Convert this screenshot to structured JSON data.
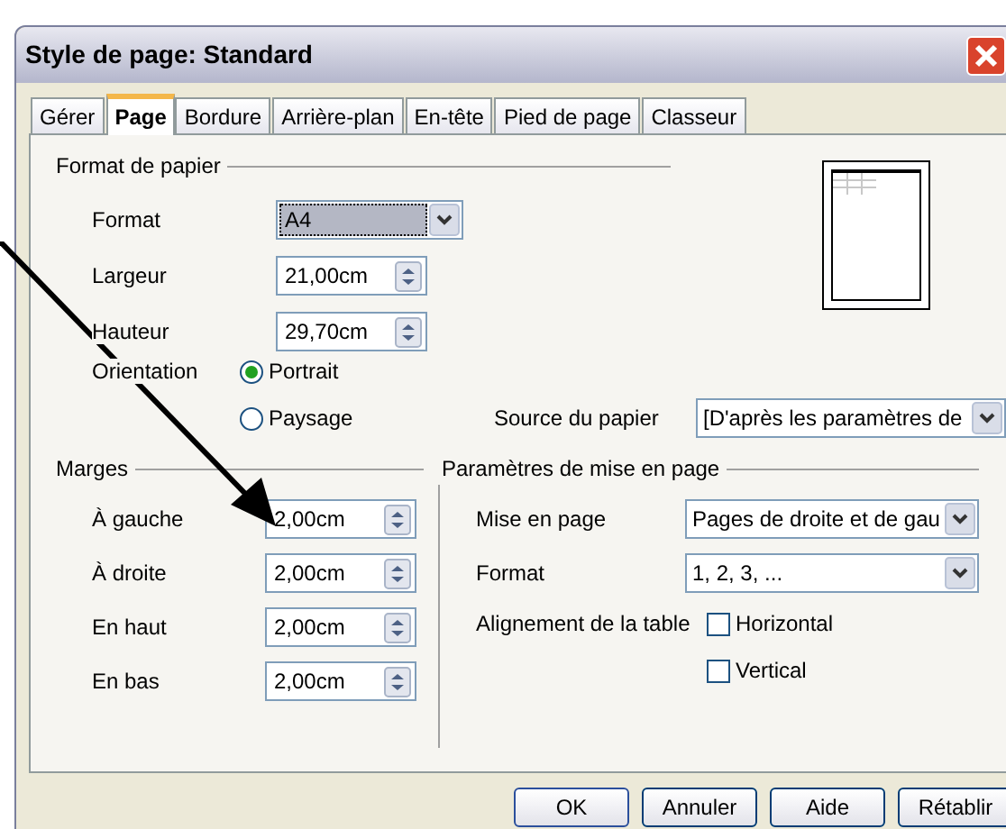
{
  "window": {
    "title": "Style de page: Standard"
  },
  "tabs": [
    {
      "label": "Gérer",
      "selected": false
    },
    {
      "label": "Page",
      "selected": true
    },
    {
      "label": "Bordure",
      "selected": false
    },
    {
      "label": "Arrière-plan",
      "selected": false
    },
    {
      "label": "En-tête",
      "selected": false
    },
    {
      "label": "Pied de page",
      "selected": false
    },
    {
      "label": "Classeur",
      "selected": false
    }
  ],
  "paper_format": {
    "heading": "Format de papier",
    "format": {
      "label": "Format",
      "value": "A4"
    },
    "width": {
      "label": "Largeur",
      "value": "21,00cm"
    },
    "height": {
      "label": "Hauteur",
      "value": "29,70cm"
    },
    "orientation": {
      "label": "Orientation",
      "options": [
        {
          "label": "Portrait",
          "selected": true
        },
        {
          "label": "Paysage",
          "selected": false
        }
      ]
    },
    "paper_source": {
      "label": "Source du papier",
      "value": "[D'après les paramètres de"
    }
  },
  "margins": {
    "heading": "Marges",
    "fields": [
      {
        "label": "À gauche",
        "value": "2,00cm"
      },
      {
        "label": "À droite",
        "value": "2,00cm"
      },
      {
        "label": "En haut",
        "value": "2,00cm"
      },
      {
        "label": "En bas",
        "value": "2,00cm"
      }
    ]
  },
  "layout_settings": {
    "heading": "Paramètres de mise en page",
    "page_layout": {
      "label": "Mise en page",
      "value": "Pages de droite et de gau"
    },
    "format": {
      "label": "Format",
      "value": "1, 2, 3, ..."
    },
    "table_alignment": {
      "label": "Alignement de la table",
      "options": [
        {
          "label": "Horizontal",
          "checked": false
        },
        {
          "label": "Vertical",
          "checked": false
        }
      ]
    }
  },
  "buttons": [
    "OK",
    "Annuler",
    "Aide",
    "Rétablir"
  ]
}
